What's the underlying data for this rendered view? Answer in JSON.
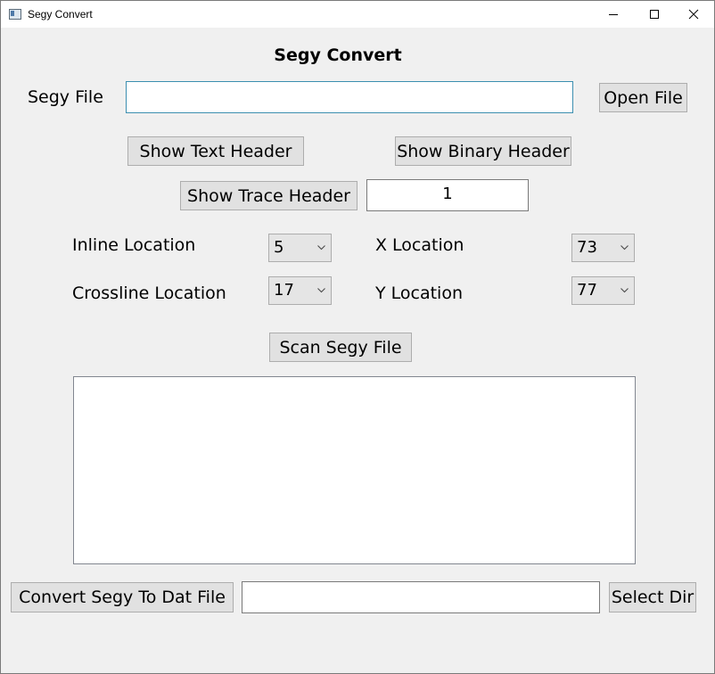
{
  "window": {
    "title": "Segy Convert"
  },
  "heading": "Segy Convert",
  "segy_file": {
    "label": "Segy File",
    "value": "",
    "open_button": "Open File"
  },
  "header_buttons": {
    "text_header": "Show Text Header",
    "binary_header": "Show Binary Header",
    "trace_header": "Show Trace Header",
    "trace_number": "1"
  },
  "locations": {
    "inline_label": "Inline Location",
    "inline_value": "5",
    "crossline_label": "Crossline Location",
    "crossline_value": "17",
    "x_label": "X Location",
    "x_value": "73",
    "y_label": "Y Location",
    "y_value": "77"
  },
  "scan_button": "Scan Segy File",
  "convert": {
    "button": "Convert Segy To Dat File",
    "dir_value": "",
    "select_dir_button": "Select Dir"
  }
}
